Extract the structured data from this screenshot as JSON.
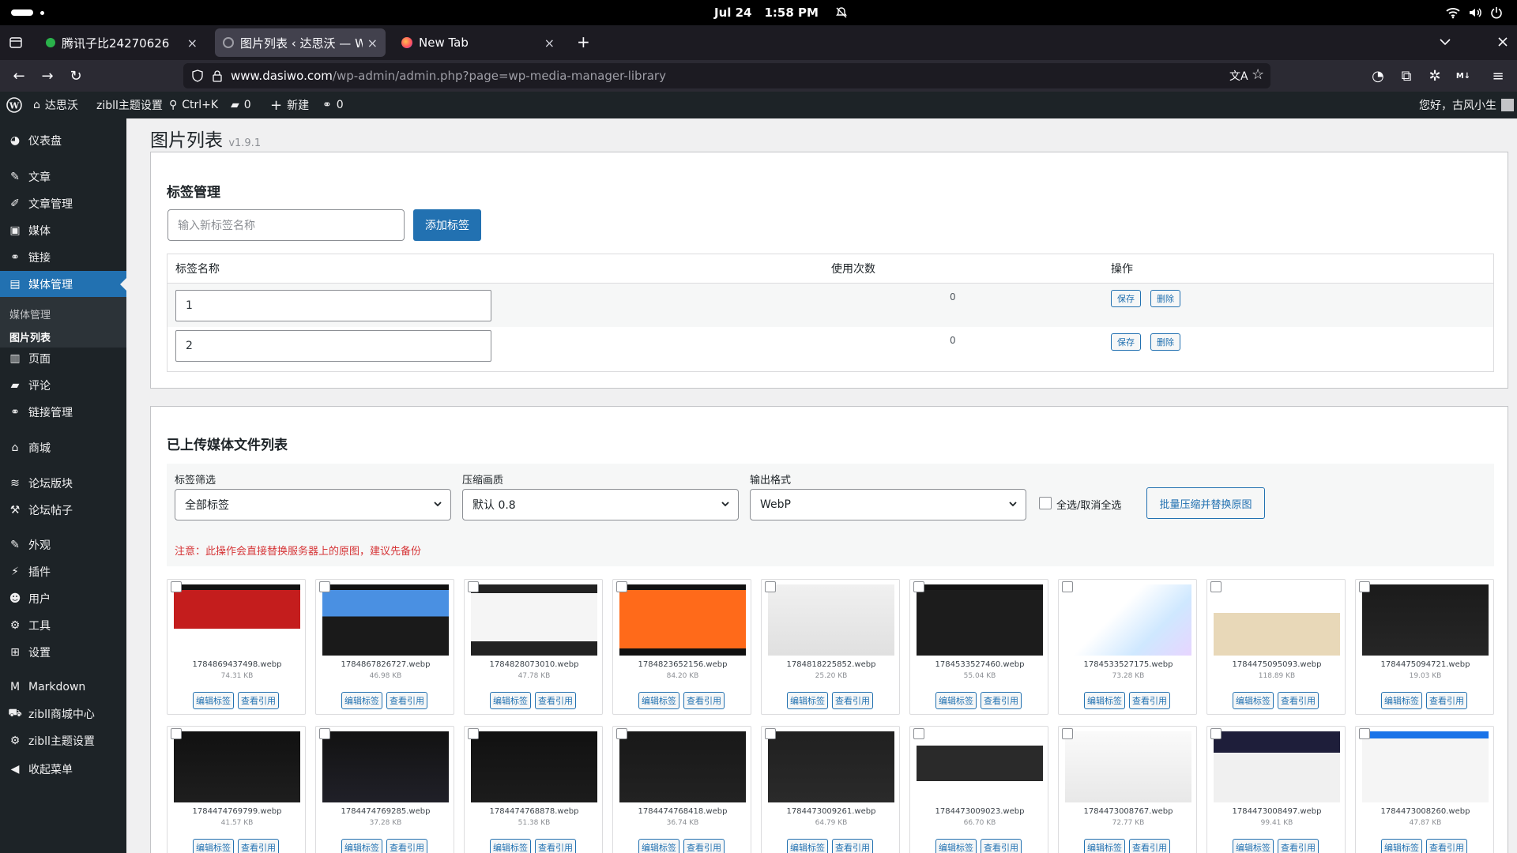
{
  "system": {
    "date": "Jul 24",
    "time": "1:58 PM"
  },
  "tabs": [
    {
      "title": "腾讯子比24270626",
      "close": "×"
    },
    {
      "title": "图片列表 ‹ 达思沃 — Word",
      "close": "×"
    },
    {
      "title": "New Tab",
      "close": "×"
    }
  ],
  "browser": {
    "new_tab": "+",
    "url_domain": "www.dasiwo.com",
    "url_path": "/wp-admin/admin.php?page=wp-media-manager-library"
  },
  "adminbar": {
    "site_name": "达思沃",
    "theme_settings": "zibll主题设置",
    "search_shortcut": "Ctrl+K",
    "comments_count": "0",
    "new_label": "新建",
    "links_count": "0",
    "greeting": "您好，古风小生"
  },
  "sidebar": {
    "items": [
      {
        "label": "仪表盘",
        "icon": "dashboard-icon"
      },
      {
        "label": "文章",
        "icon": "pin-icon"
      },
      {
        "label": "文章管理",
        "icon": "edit-icon"
      },
      {
        "label": "媒体",
        "icon": "media-icon"
      },
      {
        "label": "链接",
        "icon": "link-icon"
      },
      {
        "label": "媒体管理",
        "icon": "image-icon"
      },
      {
        "label": "页面",
        "icon": "page-icon"
      },
      {
        "label": "评论",
        "icon": "comment-icon"
      },
      {
        "label": "链接管理",
        "icon": "link-icon"
      },
      {
        "label": "商城",
        "icon": "store-icon"
      },
      {
        "label": "论坛版块",
        "icon": "forum-icon"
      },
      {
        "label": "论坛帖子",
        "icon": "hammer-icon"
      },
      {
        "label": "外观",
        "icon": "brush-icon"
      },
      {
        "label": "插件",
        "icon": "plugin-icon"
      },
      {
        "label": "用户",
        "icon": "user-icon"
      },
      {
        "label": "工具",
        "icon": "wrench-icon"
      },
      {
        "label": "设置",
        "icon": "settings-icon"
      },
      {
        "label": "Markdown",
        "icon": "markdown-icon"
      },
      {
        "label": "zibll商城中心",
        "icon": "cart-icon"
      },
      {
        "label": "zibll主题设置",
        "icon": "gear-icon"
      },
      {
        "label": "收起菜单",
        "icon": "collapse-icon"
      }
    ],
    "submenu": [
      "媒体管理",
      "图片列表"
    ]
  },
  "page": {
    "title": "图片列表",
    "version": "v1.9.1"
  },
  "tag_manager": {
    "heading": "标签管理",
    "input_placeholder": "输入新标签名称",
    "add_button": "添加标签",
    "columns": [
      "标签名称",
      "使用次数",
      "操作"
    ],
    "rows": [
      {
        "name": "1",
        "count": "0",
        "save": "保存",
        "delete": "删除"
      },
      {
        "name": "2",
        "count": "0",
        "save": "保存",
        "delete": "删除"
      }
    ]
  },
  "media_list": {
    "heading": "已上传媒体文件列表",
    "filters": {
      "tag_label": "标签筛选",
      "tag_value": "全部标签",
      "quality_label": "压缩画质",
      "quality_value": "默认 0.8",
      "format_label": "输出格式",
      "format_value": "WebP"
    },
    "select_all": "全选/取消全选",
    "bulk_button": "批量压缩并替换原图",
    "warning": "注意：此操作会直接替换服务器上的原图，建议先备份",
    "edit_tag": "编辑标签",
    "view_refs": "查看引用",
    "files": [
      {
        "name": "1784869437498.webp",
        "size": "74.31 KB"
      },
      {
        "name": "1784867826727.webp",
        "size": "46.98 KB"
      },
      {
        "name": "1784828073010.webp",
        "size": "47.78 KB"
      },
      {
        "name": "1784823652156.webp",
        "size": "84.20 KB"
      },
      {
        "name": "1784818225852.webp",
        "size": "25.20 KB"
      },
      {
        "name": "1784533527460.webp",
        "size": "55.04 KB"
      },
      {
        "name": "1784533527175.webp",
        "size": "73.28 KB"
      },
      {
        "name": "1784475095093.webp",
        "size": "118.89 KB"
      },
      {
        "name": "1784475094721.webp",
        "size": "19.03 KB"
      },
      {
        "name": "1784474769799.webp",
        "size": "41.57 KB"
      },
      {
        "name": "1784474769285.webp",
        "size": "37.28 KB"
      },
      {
        "name": "1784474768878.webp",
        "size": "51.38 KB"
      },
      {
        "name": "1784474768418.webp",
        "size": "36.74 KB"
      },
      {
        "name": "1784473009261.webp",
        "size": "64.79 KB"
      },
      {
        "name": "1784473009023.webp",
        "size": "66.70 KB"
      },
      {
        "name": "1784473008767.webp",
        "size": "72.77 KB"
      },
      {
        "name": "1784473008497.webp",
        "size": "99.41 KB"
      },
      {
        "name": "1784473008260.webp",
        "size": "47.87 KB"
      }
    ]
  },
  "colors": {
    "accent": "#2271b1",
    "warning": "#d63638",
    "sidebar_bg": "#1d2327"
  }
}
